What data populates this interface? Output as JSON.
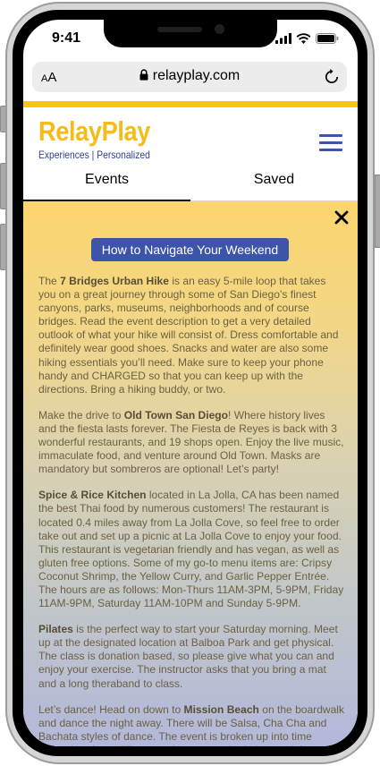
{
  "status_bar": {
    "time": "9:41"
  },
  "browser": {
    "text_size_label_small": "A",
    "text_size_label_large": "A",
    "url": "relayplay.com"
  },
  "brand": {
    "name": "RelayPlay",
    "tagline": "Experiences | Personalized"
  },
  "tabs": [
    {
      "label": "Events",
      "active": true
    },
    {
      "label": "Saved",
      "active": false
    }
  ],
  "panel": {
    "guide_button": "How to Navigate Your Weekend",
    "events": [
      {
        "lead": "The ",
        "name": "7 Bridges Urban Hike",
        "text": " is an easy 5-mile loop that takes you on a great journey through some of San Diego’s finest canyons, parks, museums, neighborhoods and of course bridges. Read the event description to get a very detailed outlook of what your hike will consist of. Dress comfortable and definitely wear good shoes. Snacks and water are also some hiking essentials you’ll need. Make sure to keep your phone handy and CHARGED so that you can keep up with the directions. Bring a hiking buddy, or two."
      },
      {
        "lead": "Make the drive to ",
        "name": "Old Town San Diego",
        "text": "! Where history lives and the fiesta lasts forever. The Fiesta de Reyes is back with 3 wonderful restaurants, and 19 shops open. Enjoy the live music, immaculate food, and venture around Old Town. Masks are mandatory but sombreros are optional! Let’s party!"
      },
      {
        "lead": "",
        "name": "Spice & Rice Kitchen",
        "text": " located in La Jolla, CA has been named the best Thai food by numerous customers! The restaurant is located 0.4 miles away from La Jolla Cove, so feel free to order take out and set up a picnic at La Jolla Cove to enjoy your food. This restaurant is vegetarian friendly and has vegan, as well as gluten free options. Some of my go-to menu items are: Cripsy Coconut Shrimp, the Yellow Curry, and Garlic Pepper Entrée. The hours are as follows: Mon-Thurs 11AM-3PM, 5-9PM, Friday 11AM-9PM, Saturday 11AM-10PM and Sunday 5-9PM."
      },
      {
        "lead": "",
        "name": "Pilates",
        "text": " is the perfect way to start your Saturday morning. Meet up at the designated location at Balboa Park and get physical. The class is donation based, so please give what you can and enjoy your exercise. The instructor asks that you bring a mat and a long theraband to class."
      },
      {
        "lead": "Let’s dance! Head on down to ",
        "name": "Mission Beach",
        "text": " on the boardwalk and dance the night away. There will be Salsa, Cha Cha and Bachata styles of dance. The event is broken up into time intervals, where different styles are taught during each interval. The event takes place from 4:15-8:30PM, so read the even description and show up whenever fits best for you and your"
      }
    ]
  },
  "colors": {
    "brand_yellow": "#f5c518",
    "brand_blue": "#3d55a8"
  }
}
